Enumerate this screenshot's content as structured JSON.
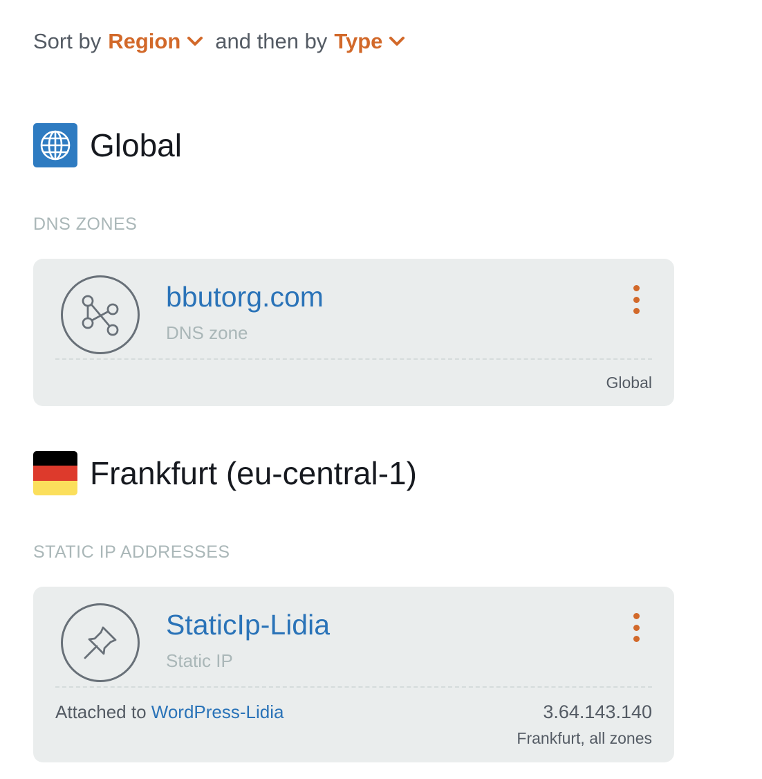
{
  "sort": {
    "prefix": "Sort by",
    "primary": "Region",
    "between": "and then by",
    "secondary": "Type"
  },
  "groups": [
    {
      "region": "Global",
      "icon": "globe-icon",
      "section_label": "DNS ZONES",
      "resource": {
        "name": "bbutorg.com",
        "type": "DNS zone",
        "icon": "dns-zone-icon",
        "footer_location": "Global"
      }
    },
    {
      "region": "Frankfurt (eu-central-1)",
      "icon": "germany-flag-icon",
      "section_label": "STATIC IP ADDRESSES",
      "resource": {
        "name": "StaticIp-Lidia",
        "type": "Static IP",
        "icon": "pushpin-icon",
        "attached_prefix": "Attached to",
        "attached_to": "WordPress-Lidia",
        "ip_address": "3.64.143.140",
        "footer_location": "Frankfurt, all zones"
      }
    }
  ],
  "colors": {
    "accent": "#d2692a",
    "link": "#2a73b8",
    "card_bg": "#eaeded",
    "muted": "#aab7b8",
    "globe_badge": "#2e7bc1",
    "flag": [
      "#000000",
      "#dd3a2c",
      "#fbdf5c"
    ]
  }
}
